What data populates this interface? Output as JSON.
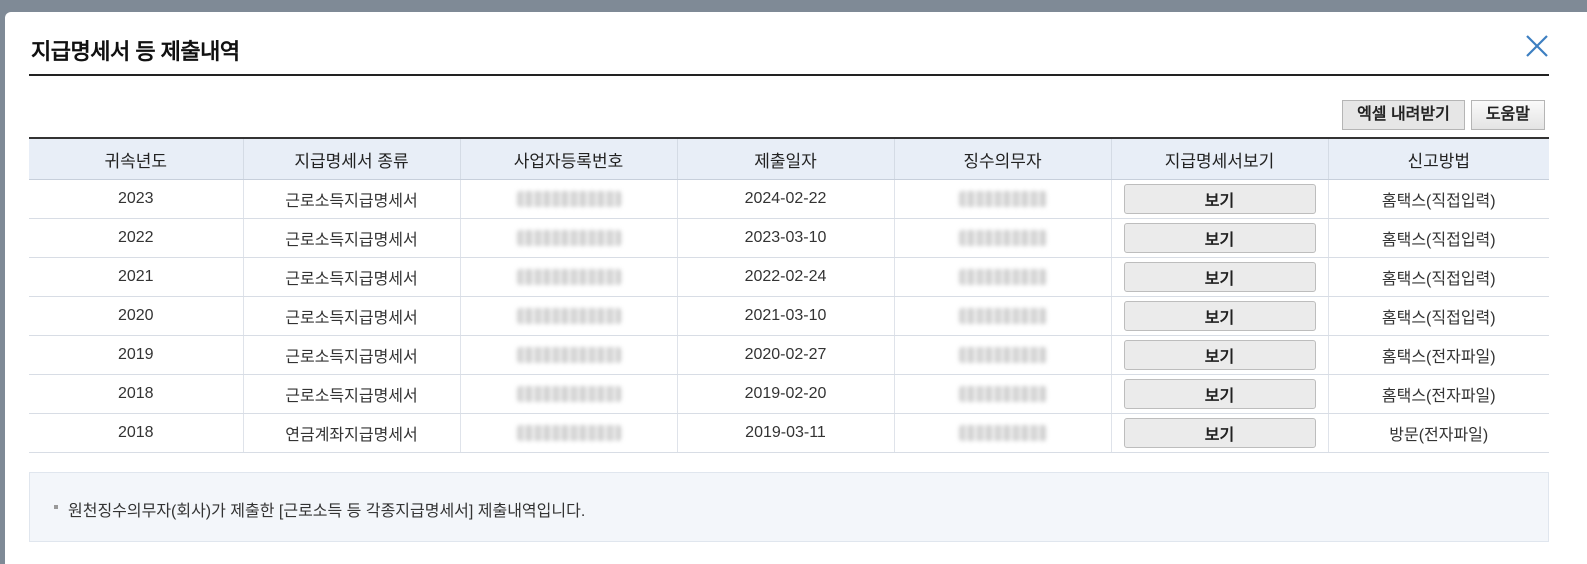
{
  "dialog": {
    "title": "지급명세서 등 제출내역",
    "close_icon": "close-icon"
  },
  "toolbar": {
    "excel_label": "엑셀 내려받기",
    "help_label": "도움말"
  },
  "table": {
    "headers": [
      "귀속년도",
      "지급명세서 종류",
      "사업자등록번호",
      "제출일자",
      "징수의무자",
      "지급명세서보기",
      "신고방법"
    ],
    "view_label": "보기",
    "rows": [
      {
        "year": "2023",
        "type": "근로소득지급명세서",
        "date": "2024-02-22",
        "method": "홈택스(직접입력)"
      },
      {
        "year": "2022",
        "type": "근로소득지급명세서",
        "date": "2023-03-10",
        "method": "홈택스(직접입력)"
      },
      {
        "year": "2021",
        "type": "근로소득지급명세서",
        "date": "2022-02-24",
        "method": "홈택스(직접입력)"
      },
      {
        "year": "2020",
        "type": "근로소득지급명세서",
        "date": "2021-03-10",
        "method": "홈택스(직접입력)"
      },
      {
        "year": "2019",
        "type": "근로소득지급명세서",
        "date": "2020-02-27",
        "method": "홈택스(전자파일)"
      },
      {
        "year": "2018",
        "type": "근로소득지급명세서",
        "date": "2019-02-20",
        "method": "홈택스(전자파일)"
      },
      {
        "year": "2018",
        "type": "연금계좌지급명세서",
        "date": "2019-03-11",
        "method": "방문(전자파일)"
      }
    ]
  },
  "notice": {
    "text": "원천징수의무자(회사)가 제출한 [근로소득 등 각종지급명세서] 제출내역입니다."
  }
}
